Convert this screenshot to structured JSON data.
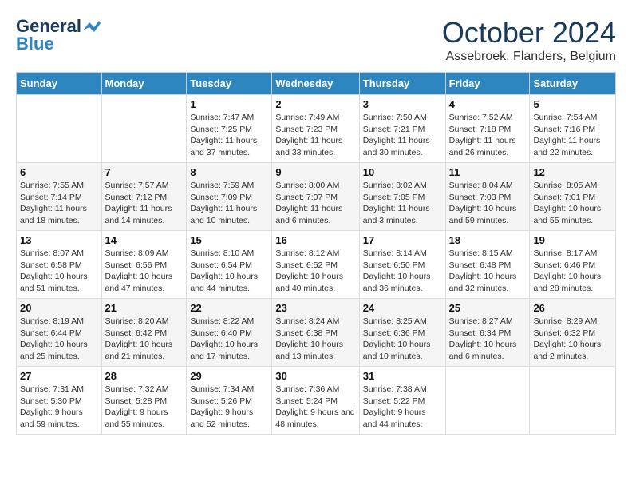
{
  "header": {
    "logo_line1": "General",
    "logo_line2": "Blue",
    "month_title": "October 2024",
    "subtitle": "Assebroek, Flanders, Belgium"
  },
  "days_of_week": [
    "Sunday",
    "Monday",
    "Tuesday",
    "Wednesday",
    "Thursday",
    "Friday",
    "Saturday"
  ],
  "weeks": [
    [
      {
        "day": "",
        "sunrise": "",
        "sunset": "",
        "daylight": ""
      },
      {
        "day": "",
        "sunrise": "",
        "sunset": "",
        "daylight": ""
      },
      {
        "day": "1",
        "sunrise": "Sunrise: 7:47 AM",
        "sunset": "Sunset: 7:25 PM",
        "daylight": "Daylight: 11 hours and 37 minutes."
      },
      {
        "day": "2",
        "sunrise": "Sunrise: 7:49 AM",
        "sunset": "Sunset: 7:23 PM",
        "daylight": "Daylight: 11 hours and 33 minutes."
      },
      {
        "day": "3",
        "sunrise": "Sunrise: 7:50 AM",
        "sunset": "Sunset: 7:21 PM",
        "daylight": "Daylight: 11 hours and 30 minutes."
      },
      {
        "day": "4",
        "sunrise": "Sunrise: 7:52 AM",
        "sunset": "Sunset: 7:18 PM",
        "daylight": "Daylight: 11 hours and 26 minutes."
      },
      {
        "day": "5",
        "sunrise": "Sunrise: 7:54 AM",
        "sunset": "Sunset: 7:16 PM",
        "daylight": "Daylight: 11 hours and 22 minutes."
      }
    ],
    [
      {
        "day": "6",
        "sunrise": "Sunrise: 7:55 AM",
        "sunset": "Sunset: 7:14 PM",
        "daylight": "Daylight: 11 hours and 18 minutes."
      },
      {
        "day": "7",
        "sunrise": "Sunrise: 7:57 AM",
        "sunset": "Sunset: 7:12 PM",
        "daylight": "Daylight: 11 hours and 14 minutes."
      },
      {
        "day": "8",
        "sunrise": "Sunrise: 7:59 AM",
        "sunset": "Sunset: 7:09 PM",
        "daylight": "Daylight: 11 hours and 10 minutes."
      },
      {
        "day": "9",
        "sunrise": "Sunrise: 8:00 AM",
        "sunset": "Sunset: 7:07 PM",
        "daylight": "Daylight: 11 hours and 6 minutes."
      },
      {
        "day": "10",
        "sunrise": "Sunrise: 8:02 AM",
        "sunset": "Sunset: 7:05 PM",
        "daylight": "Daylight: 11 hours and 3 minutes."
      },
      {
        "day": "11",
        "sunrise": "Sunrise: 8:04 AM",
        "sunset": "Sunset: 7:03 PM",
        "daylight": "Daylight: 10 hours and 59 minutes."
      },
      {
        "day": "12",
        "sunrise": "Sunrise: 8:05 AM",
        "sunset": "Sunset: 7:01 PM",
        "daylight": "Daylight: 10 hours and 55 minutes."
      }
    ],
    [
      {
        "day": "13",
        "sunrise": "Sunrise: 8:07 AM",
        "sunset": "Sunset: 6:58 PM",
        "daylight": "Daylight: 10 hours and 51 minutes."
      },
      {
        "day": "14",
        "sunrise": "Sunrise: 8:09 AM",
        "sunset": "Sunset: 6:56 PM",
        "daylight": "Daylight: 10 hours and 47 minutes."
      },
      {
        "day": "15",
        "sunrise": "Sunrise: 8:10 AM",
        "sunset": "Sunset: 6:54 PM",
        "daylight": "Daylight: 10 hours and 44 minutes."
      },
      {
        "day": "16",
        "sunrise": "Sunrise: 8:12 AM",
        "sunset": "Sunset: 6:52 PM",
        "daylight": "Daylight: 10 hours and 40 minutes."
      },
      {
        "day": "17",
        "sunrise": "Sunrise: 8:14 AM",
        "sunset": "Sunset: 6:50 PM",
        "daylight": "Daylight: 10 hours and 36 minutes."
      },
      {
        "day": "18",
        "sunrise": "Sunrise: 8:15 AM",
        "sunset": "Sunset: 6:48 PM",
        "daylight": "Daylight: 10 hours and 32 minutes."
      },
      {
        "day": "19",
        "sunrise": "Sunrise: 8:17 AM",
        "sunset": "Sunset: 6:46 PM",
        "daylight": "Daylight: 10 hours and 28 minutes."
      }
    ],
    [
      {
        "day": "20",
        "sunrise": "Sunrise: 8:19 AM",
        "sunset": "Sunset: 6:44 PM",
        "daylight": "Daylight: 10 hours and 25 minutes."
      },
      {
        "day": "21",
        "sunrise": "Sunrise: 8:20 AM",
        "sunset": "Sunset: 6:42 PM",
        "daylight": "Daylight: 10 hours and 21 minutes."
      },
      {
        "day": "22",
        "sunrise": "Sunrise: 8:22 AM",
        "sunset": "Sunset: 6:40 PM",
        "daylight": "Daylight: 10 hours and 17 minutes."
      },
      {
        "day": "23",
        "sunrise": "Sunrise: 8:24 AM",
        "sunset": "Sunset: 6:38 PM",
        "daylight": "Daylight: 10 hours and 13 minutes."
      },
      {
        "day": "24",
        "sunrise": "Sunrise: 8:25 AM",
        "sunset": "Sunset: 6:36 PM",
        "daylight": "Daylight: 10 hours and 10 minutes."
      },
      {
        "day": "25",
        "sunrise": "Sunrise: 8:27 AM",
        "sunset": "Sunset: 6:34 PM",
        "daylight": "Daylight: 10 hours and 6 minutes."
      },
      {
        "day": "26",
        "sunrise": "Sunrise: 8:29 AM",
        "sunset": "Sunset: 6:32 PM",
        "daylight": "Daylight: 10 hours and 2 minutes."
      }
    ],
    [
      {
        "day": "27",
        "sunrise": "Sunrise: 7:31 AM",
        "sunset": "Sunset: 5:30 PM",
        "daylight": "Daylight: 9 hours and 59 minutes."
      },
      {
        "day": "28",
        "sunrise": "Sunrise: 7:32 AM",
        "sunset": "Sunset: 5:28 PM",
        "daylight": "Daylight: 9 hours and 55 minutes."
      },
      {
        "day": "29",
        "sunrise": "Sunrise: 7:34 AM",
        "sunset": "Sunset: 5:26 PM",
        "daylight": "Daylight: 9 hours and 52 minutes."
      },
      {
        "day": "30",
        "sunrise": "Sunrise: 7:36 AM",
        "sunset": "Sunset: 5:24 PM",
        "daylight": "Daylight: 9 hours and 48 minutes."
      },
      {
        "day": "31",
        "sunrise": "Sunrise: 7:38 AM",
        "sunset": "Sunset: 5:22 PM",
        "daylight": "Daylight: 9 hours and 44 minutes."
      },
      {
        "day": "",
        "sunrise": "",
        "sunset": "",
        "daylight": ""
      },
      {
        "day": "",
        "sunrise": "",
        "sunset": "",
        "daylight": ""
      }
    ]
  ]
}
